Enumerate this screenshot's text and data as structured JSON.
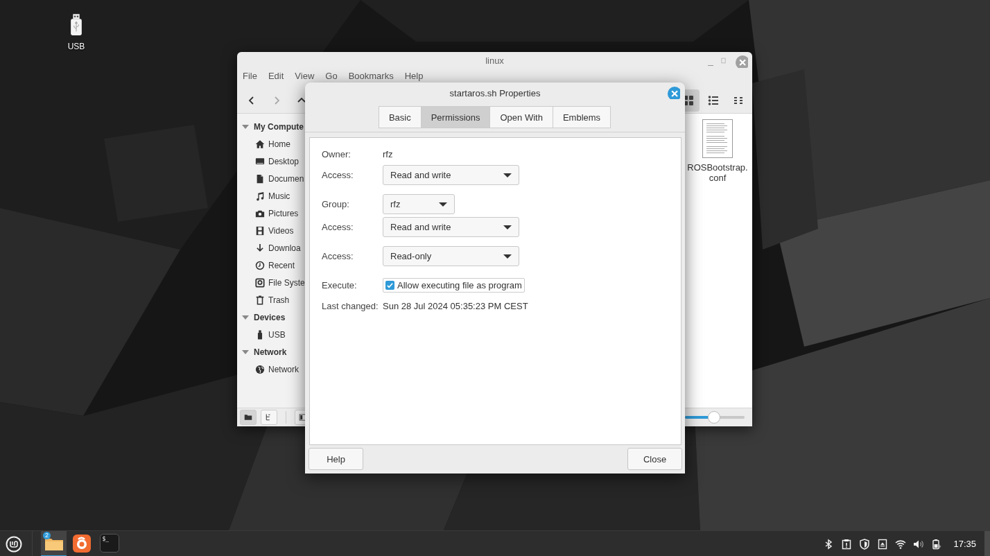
{
  "desktop": {
    "icons": [
      {
        "label": "USB",
        "kind": "usb"
      }
    ]
  },
  "file_manager": {
    "title": "linux",
    "menu": [
      "File",
      "Edit",
      "View",
      "Go",
      "Bookmarks",
      "Help"
    ],
    "nav_buttons": [
      {
        "kind": "back",
        "disabled": false
      },
      {
        "kind": "forward",
        "disabled": true
      },
      {
        "kind": "up",
        "disabled": false
      }
    ],
    "view_buttons": [
      {
        "kind": "icons",
        "selected": true
      },
      {
        "kind": "list",
        "selected": false
      },
      {
        "kind": "compact",
        "selected": false
      }
    ],
    "sidebar": [
      {
        "heading": "My Compute",
        "expanded": true,
        "items": [
          {
            "label": "Home",
            "kind": "home"
          },
          {
            "label": "Desktop",
            "kind": "desktop"
          },
          {
            "label": "Documen",
            "kind": "document"
          },
          {
            "label": "Music",
            "kind": "music"
          },
          {
            "label": "Pictures",
            "kind": "camera"
          },
          {
            "label": "Videos",
            "kind": "film"
          },
          {
            "label": "Downloa",
            "kind": "download"
          },
          {
            "label": "Recent",
            "kind": "clock"
          },
          {
            "label": "File Syste",
            "kind": "disk"
          },
          {
            "label": "Trash",
            "kind": "trash"
          }
        ]
      },
      {
        "heading": "Devices",
        "expanded": true,
        "items": [
          {
            "label": "USB",
            "kind": "usb"
          }
        ]
      },
      {
        "heading": "Network",
        "expanded": true,
        "items": [
          {
            "label": "Network",
            "kind": "globe"
          }
        ]
      }
    ],
    "files": [
      {
        "name": "ROSBootstrap.conf"
      }
    ],
    "status_buttons": [
      {
        "kind": "places",
        "selected": true
      },
      {
        "kind": "tree",
        "selected": false
      },
      {
        "kind": "sidebar",
        "selected": false
      }
    ],
    "zoom": {
      "level": 0.49
    }
  },
  "dialog": {
    "title": "startaros.sh Properties",
    "tabs": [
      {
        "label": "Basic",
        "selected": false
      },
      {
        "label": "Permissions",
        "selected": true
      },
      {
        "label": "Open With",
        "selected": false
      },
      {
        "label": "Emblems",
        "selected": false
      }
    ],
    "sections": [
      [
        {
          "kind": "text",
          "label": "Owner:",
          "value": "rfz"
        },
        {
          "kind": "dropdown",
          "label": "Access:",
          "value": "Read and write"
        }
      ],
      [
        {
          "kind": "combo",
          "label": "Group:",
          "value": "rfz"
        },
        {
          "kind": "dropdown",
          "label": "Access:",
          "value": "Read and write"
        }
      ],
      [
        {
          "kind": "dropdown",
          "label": "Access:",
          "value": "Read-only"
        }
      ],
      [
        {
          "kind": "checkbox",
          "label": "Execute:",
          "value": "Allow executing file as program",
          "checked": true
        },
        {
          "kind": "text",
          "label": "Last changed:",
          "value": "Sun 28 Jul 2024 05:35:23 PM CEST"
        }
      ]
    ],
    "buttons": [
      "Help",
      "Close"
    ]
  },
  "taskbar": {
    "apps": [
      {
        "kind": "files",
        "selected": true,
        "badge": "2"
      },
      {
        "kind": "browser",
        "selected": false
      },
      {
        "kind": "terminal",
        "selected": false,
        "glyph": "$_"
      }
    ],
    "tray": [
      {
        "kind": "bluetooth"
      },
      {
        "kind": "clipboard"
      },
      {
        "kind": "shield"
      },
      {
        "kind": "eject"
      },
      {
        "kind": "wifi"
      },
      {
        "kind": "volume"
      },
      {
        "kind": "battery"
      }
    ],
    "clock": "17:35"
  }
}
